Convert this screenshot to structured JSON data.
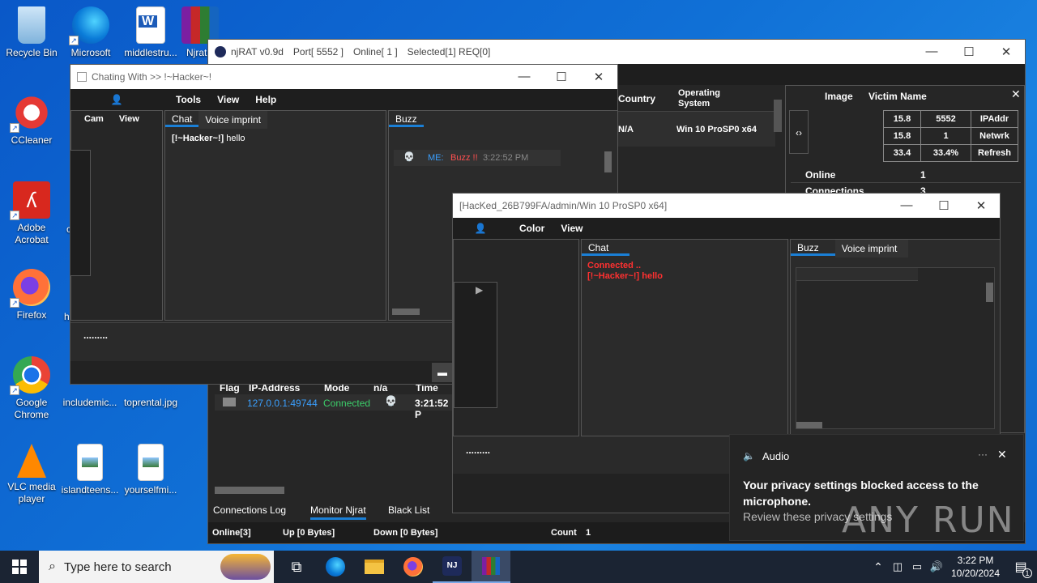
{
  "desktop": {
    "icons": [
      {
        "label": "Recycle Bin"
      },
      {
        "label": "Microsoft Edge"
      },
      {
        "label": "middlestru..."
      },
      {
        "label": "Njrat"
      },
      {
        "label": "CCleaner"
      },
      {
        "label": "Adobe Acrobat"
      },
      {
        "label": "Firefox"
      },
      {
        "label": "Google Chrome"
      },
      {
        "label": "includemic..."
      },
      {
        "label": "toprental.jpg"
      },
      {
        "label": "VLC media player"
      },
      {
        "label": "islandteens..."
      },
      {
        "label": "yourselfmi..."
      }
    ],
    "partial_labels": [
      "c",
      "h"
    ]
  },
  "njrat": {
    "title": "njRAT v0.9d",
    "port": "Port[ 5552 ]",
    "online": "Online[ 1 ]",
    "selected": "Selected[1] REQ[0]",
    "columns": {
      "country": "Country",
      "os": "Operating System"
    },
    "row": {
      "country": "N/A",
      "os": "Win 10 ProSP0 x64"
    },
    "side_header": {
      "image": "Image",
      "victim": "Victim Name"
    },
    "stats": [
      [
        "15.8",
        "5552",
        "IPAddr"
      ],
      [
        "15.8",
        "1",
        "Netwrk"
      ],
      [
        "33.4",
        "33.4%",
        "Refresh"
      ]
    ],
    "info": [
      {
        "k": "Online",
        "v": "1"
      },
      {
        "k": "Connections",
        "v": "3"
      }
    ],
    "log_columns": {
      "flag": "Flag",
      "ip": "IP-Address",
      "mode": "Mode",
      "na": "n/a",
      "time": "Time"
    },
    "log_row": {
      "ip": "127.0.0.1:49744",
      "mode": "Connected",
      "time": "3:21:52 P"
    },
    "tabs": [
      "Connections Log",
      "Monitor Njrat",
      "Black List"
    ],
    "status": {
      "online": "Online[3]",
      "up": "Up [0 Bytes]",
      "down": "Down [0 Bytes]",
      "count_label": "Count",
      "count": "1"
    }
  },
  "chat1": {
    "title": "Chating With >> !~Hacker~!",
    "menu": [
      "Tools",
      "View",
      "Help"
    ],
    "left_menu": [
      "Cam",
      "View"
    ],
    "tabs": [
      "Chat",
      "Voice imprint"
    ],
    "buzz_tab": "Buzz",
    "message_sender": "[!~Hacker~!]",
    "message_text": "hello",
    "buzz_row": {
      "me": "ME:",
      "buzz": "Buzz !!",
      "time": "3:22:52 PM"
    },
    "input_text": "........."
  },
  "chat2": {
    "title": "[HacKed_26B799FA/admin/Win 10 ProSP0 x64]",
    "menu": [
      "Color",
      "View"
    ],
    "chat_tab": "Chat",
    "tabs": [
      "Buzz",
      "Voice imprint"
    ],
    "line1": "Connected ..",
    "line2": "[!~Hacker~!] hello",
    "input_text": "........."
  },
  "notification": {
    "app": "Audio",
    "title": "Your privacy settings blocked access to the microphone.",
    "body": "Review these privacy settings",
    "watermark": "ANY RUN"
  },
  "taskbar": {
    "search_placeholder": "Type here to search",
    "time": "3:22 PM",
    "date": "10/20/2024",
    "notif_count": "1"
  }
}
